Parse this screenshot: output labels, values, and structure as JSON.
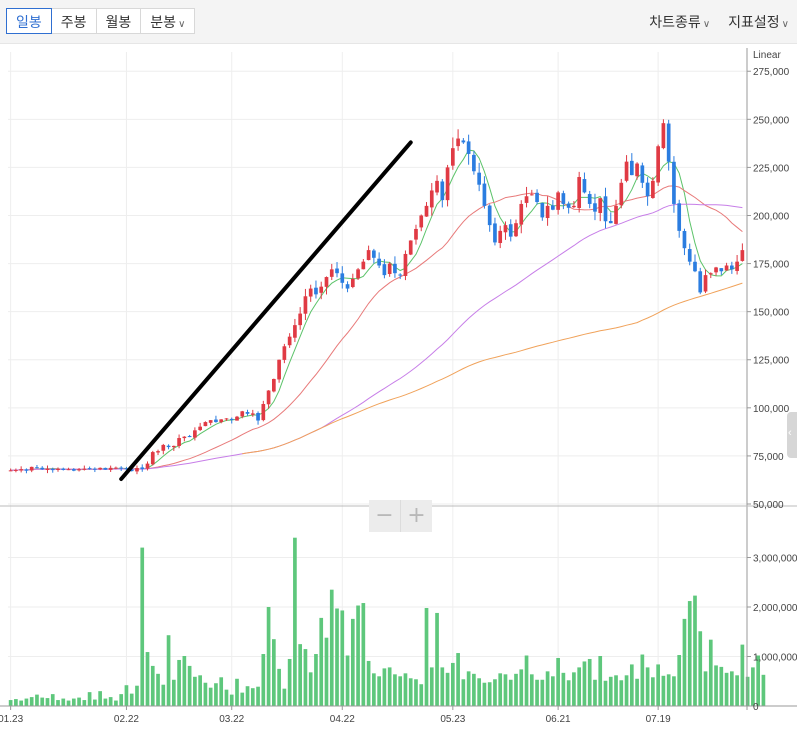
{
  "toolbar": {
    "tabs": [
      {
        "label": "일봉",
        "active": true
      },
      {
        "label": "주봉"
      },
      {
        "label": "월봉"
      },
      {
        "label": "분봉",
        "dropdown": true
      }
    ],
    "chart_type_label": "차트종류",
    "indicator_label": "지표설정",
    "caret": "∨"
  },
  "zoom": {
    "minus": "−",
    "plus": "+"
  },
  "scale_label": "Linear",
  "colors": {
    "up": "#e03a44",
    "down": "#2b7de0",
    "volume": "#5ec77c",
    "ma5": "#5cc36a",
    "ma20": "#e87a7a",
    "ma60": "#c77ee8",
    "ma120": "#f0a25a",
    "trendline": "#000000",
    "grid": "#eeeeee"
  },
  "chart_data": [
    {
      "type": "candlestick",
      "scale": "linear",
      "ylim": [
        50000,
        285000
      ],
      "yticks": [
        "50,000",
        "75,000",
        "100,000",
        "125,000",
        "150,000",
        "175,000",
        "200,000",
        "225,000",
        "250,000",
        "275,000"
      ],
      "x_tick_labels": [
        {
          "label": "01.23",
          "index": 0
        },
        {
          "label": "02.22",
          "index": 22
        },
        {
          "label": "03.22",
          "index": 42
        },
        {
          "label": "04.22",
          "index": 63
        },
        {
          "label": "05.23",
          "index": 84
        },
        {
          "label": "06.21",
          "index": 104
        },
        {
          "label": "07.19",
          "index": 123
        }
      ],
      "close": [
        67500,
        67700,
        68100,
        67300,
        69300,
        68800,
        68000,
        68400,
        67900,
        68300,
        67700,
        68100,
        67300,
        68100,
        68400,
        68300,
        67900,
        68800,
        67800,
        68800,
        68900,
        68600,
        68200,
        67100,
        68700,
        68200,
        71000,
        77000,
        77500,
        80700,
        79600,
        80200,
        84300,
        85000,
        84800,
        88300,
        90200,
        92600,
        93600,
        92600,
        94000,
        94500,
        93700,
        95400,
        98200,
        96900,
        97100,
        93400,
        102000,
        109000,
        115000,
        125000,
        132000,
        137000,
        143000,
        149000,
        158000,
        162000,
        159000,
        163000,
        168000,
        172000,
        170000,
        165000,
        162000,
        167000,
        172000,
        176000,
        182000,
        178000,
        174000,
        169000,
        175000,
        170000,
        169000,
        180000,
        187000,
        193000,
        200000,
        205000,
        213000,
        218000,
        208000,
        225000,
        235000,
        240000,
        238000,
        232000,
        223000,
        216000,
        205000,
        195000,
        186000,
        192000,
        195000,
        189000,
        196000,
        206000,
        210000,
        211000,
        207000,
        199000,
        205000,
        203000,
        212000,
        206000,
        204000,
        205000,
        220000,
        212000,
        206000,
        202000,
        209000,
        197000,
        196000,
        205000,
        217000,
        228000,
        221000,
        227000,
        217000,
        210000,
        218000,
        236000,
        248000,
        228000,
        206000,
        192000,
        183000,
        176000,
        171000,
        160000,
        169000,
        170000,
        173000,
        171000,
        174000,
        172000,
        176000,
        182000
      ],
      "annotation": {
        "type": "trendline",
        "from": {
          "index": 21,
          "value": 63000
        },
        "to": {
          "index": 76,
          "value": 238000
        }
      }
    },
    {
      "type": "bar",
      "series": [
        {
          "values": [
            120000,
            140000,
            110000,
            150000,
            180000,
            230000,
            170000,
            160000,
            240000,
            120000,
            150000,
            110000,
            150000,
            170000,
            120000,
            280000,
            130000,
            300000,
            150000,
            180000,
            110000,
            240000,
            420000,
            250000,
            410000,
            3200000,
            1090000,
            810000,
            650000,
            430000,
            1430000,
            530000,
            930000,
            1010000,
            810000,
            590000,
            620000,
            470000,
            370000,
            460000,
            580000,
            330000,
            230000,
            550000,
            270000,
            400000,
            360000,
            390000,
            1050000,
            2000000,
            1350000,
            750000,
            350000,
            950000,
            3400000,
            1250000,
            1150000,
            680000,
            1050000,
            1780000,
            1380000,
            2350000,
            1970000,
            1930000,
            1020000,
            1760000,
            2030000,
            2080000,
            910000,
            660000,
            600000,
            760000,
            780000,
            640000,
            600000,
            660000,
            560000,
            540000,
            440000,
            1980000,
            780000,
            1880000,
            780000,
            670000,
            870000,
            1070000,
            540000,
            700000,
            650000,
            560000,
            470000,
            480000,
            540000,
            660000,
            640000,
            530000,
            650000,
            740000,
            1020000,
            640000,
            530000,
            530000,
            700000,
            600000,
            970000,
            670000,
            520000,
            680000,
            780000,
            900000,
            950000,
            530000,
            1010000,
            510000,
            590000,
            620000,
            520000,
            620000,
            840000,
            550000,
            1040000,
            780000,
            580000,
            840000,
            610000,
            640000,
            600000,
            1030000,
            1760000,
            2120000,
            2230000,
            1510000,
            700000,
            1340000,
            820000,
            790000,
            670000,
            700000,
            620000,
            1240000,
            590000,
            780000,
            1020000,
            630000
          ],
          "color": "#5ec77c"
        }
      ],
      "ylim": [
        0,
        4000000
      ],
      "yticks": [
        "0",
        "1,000,000",
        "2,000,000",
        "3,000,000"
      ]
    }
  ]
}
